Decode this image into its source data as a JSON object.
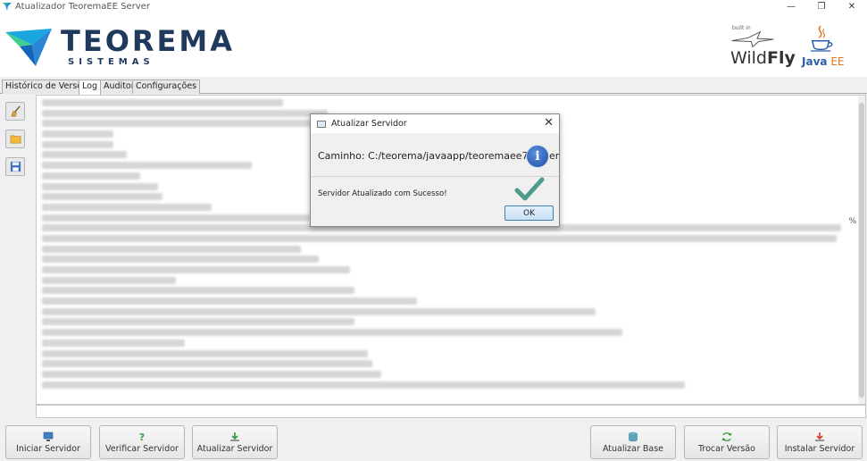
{
  "window": {
    "title": "Atualizador TeoremaEE Server",
    "minimize": "—",
    "restore": "❐",
    "close": "✕"
  },
  "header": {
    "brand": "TEOREMA",
    "brand_sub": "SISTEMAS",
    "wildfly_built": "built in",
    "wildfly_light": "Wild",
    "wildfly_bold": "Fly",
    "javaee_java": "Java",
    "javaee_ee": "EE"
  },
  "tabs": [
    {
      "label": "Histórico de Versões"
    },
    {
      "label": "Log"
    },
    {
      "label": "Auditor"
    },
    {
      "label": "Configurações"
    }
  ],
  "log": {
    "percent_fragment": "%"
  },
  "buttons": {
    "iniciar": "Iniciar Servidor",
    "verificar": "Verificar Servidor",
    "atualizar": "Atualizar Servidor",
    "atualizar_base": "Atualizar Base",
    "trocar_versao": "Trocar Versão",
    "instalar": "Instalar Servidor"
  },
  "dialog": {
    "title": "Atualizar Servidor",
    "close": "✕",
    "path": "Caminho: C:/teorema/javaapp/teoremaee7server",
    "message": "Servidor Atualizado com Sucesso!",
    "ok": "OK",
    "info_glyph": "i"
  },
  "colors": {
    "brand": "#1f3a5c",
    "accent": "#1e4fa8",
    "success": "#4e9a8c"
  }
}
